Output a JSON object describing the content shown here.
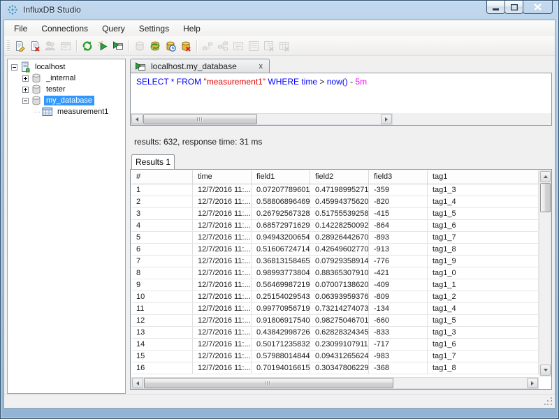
{
  "window": {
    "title": "InfluxDB Studio"
  },
  "colors": {
    "selection": "#3297fd",
    "keyword": "#0000ff",
    "string": "#e00000",
    "duration": "#ff00ff"
  },
  "menu": {
    "items": [
      "File",
      "Connections",
      "Query",
      "Settings",
      "Help"
    ]
  },
  "toolbar": {
    "buttons": [
      {
        "name": "edit-connection",
        "icon": "doc-edit",
        "enabled": true
      },
      {
        "name": "delete-connection",
        "icon": "doc-delete",
        "enabled": true
      },
      {
        "name": "manage-users",
        "icon": "users",
        "enabled": false
      },
      {
        "name": "connection-properties",
        "icon": "properties",
        "enabled": false
      },
      {
        "sep": true
      },
      {
        "name": "refresh",
        "icon": "refresh",
        "enabled": true
      },
      {
        "name": "run-query",
        "icon": "run",
        "enabled": true
      },
      {
        "name": "run-query-new-tab",
        "icon": "run-tab",
        "enabled": true
      },
      {
        "sep": true
      },
      {
        "name": "create-database",
        "icon": "database",
        "enabled": false
      },
      {
        "name": "refresh-databases",
        "icon": "database-refresh",
        "enabled": true
      },
      {
        "name": "retention-policies",
        "icon": "database-clock",
        "enabled": true
      },
      {
        "name": "drop-database",
        "icon": "database-delete",
        "enabled": true
      },
      {
        "sep": true
      },
      {
        "name": "show-queries",
        "icon": "link",
        "enabled": false
      },
      {
        "name": "show-shards",
        "icon": "link-add",
        "enabled": false
      },
      {
        "name": "show-stats",
        "icon": "view-text",
        "enabled": false
      },
      {
        "name": "show-diagnostics",
        "icon": "view-list",
        "enabled": false
      },
      {
        "name": "kill-query",
        "icon": "list-delete",
        "enabled": false
      },
      {
        "name": "drop-series",
        "icon": "table-delete",
        "enabled": false
      }
    ]
  },
  "connection_tree": {
    "nodes": [
      {
        "label": "localhost",
        "icon": "server",
        "expand": "minus",
        "level": 0,
        "selected": false
      },
      {
        "label": "_internal",
        "icon": "database",
        "expand": "plus",
        "level": 1,
        "selected": false
      },
      {
        "label": "tester",
        "icon": "database",
        "expand": "plus",
        "level": 1,
        "selected": false
      },
      {
        "label": "my_database",
        "icon": "database",
        "expand": "minus",
        "level": 1,
        "selected": true
      },
      {
        "label": "measurement1",
        "icon": "table",
        "expand": "none",
        "level": 2,
        "selected": false
      }
    ]
  },
  "query_tab": {
    "label": "localhost.my_database",
    "close_label": "x"
  },
  "query_editor": {
    "tokens": [
      {
        "text": "SELECT * FROM ",
        "color": "#0000ff"
      },
      {
        "text": "\"measurement1\"",
        "color": "#e00000"
      },
      {
        "text": " ",
        "color": "#000000"
      },
      {
        "text": "WHERE time ",
        "color": "#0000ff"
      },
      {
        "text": "> ",
        "color": "#202020"
      },
      {
        "text": "now()",
        "color": "#0000ff"
      },
      {
        "text": " - ",
        "color": "#202020"
      },
      {
        "text": "5m",
        "color": "#ff00ff"
      }
    ]
  },
  "result_summary": "results: 632, response time: 31 ms",
  "results": {
    "tab_label": "Results 1",
    "columns": [
      "#",
      "time",
      "field1",
      "field2",
      "field3",
      "tag1"
    ],
    "rows": [
      [
        "1",
        "12/7/2016 11:...",
        "0.07207789601...",
        "0.47198995271...",
        "-359",
        "tag1_3"
      ],
      [
        "2",
        "12/7/2016 11:...",
        "0.58806896469...",
        "0.45994375620...",
        "-820",
        "tag1_4"
      ],
      [
        "3",
        "12/7/2016 11:...",
        "0.26792567328...",
        "0.51755539258...",
        "-415",
        "tag1_5"
      ],
      [
        "4",
        "12/7/2016 11:...",
        "0.68572971629...",
        "0.14228250092...",
        "-864",
        "tag1_6"
      ],
      [
        "5",
        "12/7/2016 11:...",
        "0.94943200654...",
        "0.28926442670...",
        "-893",
        "tag1_7"
      ],
      [
        "6",
        "12/7/2016 11:...",
        "0.51606724714...",
        "0.42649602770...",
        "-913",
        "tag1_8"
      ],
      [
        "7",
        "12/7/2016 11:...",
        "0.36813158465...",
        "0.07929358914...",
        "-776",
        "tag1_9"
      ],
      [
        "8",
        "12/7/2016 11:...",
        "0.98993773804...",
        "0.88365307910...",
        "-421",
        "tag1_0"
      ],
      [
        "9",
        "12/7/2016 11:...",
        "0.56469987219...",
        "0.07007138620...",
        "-409",
        "tag1_1"
      ],
      [
        "10",
        "12/7/2016 11:...",
        "0.25154029543...",
        "0.06393959376...",
        "-809",
        "tag1_2"
      ],
      [
        "11",
        "12/7/2016 11:...",
        "0.99770956719...",
        "0.73214274073...",
        "-134",
        "tag1_4"
      ],
      [
        "12",
        "12/7/2016 11:...",
        "0.91806917540...",
        "0.98275046701...",
        "-660",
        "tag1_5"
      ],
      [
        "13",
        "12/7/2016 11:...",
        "0.43842998726...",
        "0.62828324345...",
        "-833",
        "tag1_3"
      ],
      [
        "14",
        "12/7/2016 11:...",
        "0.50171235832...",
        "0.23099107911...",
        "-717",
        "tag1_6"
      ],
      [
        "15",
        "12/7/2016 11:...",
        "0.57988014844...",
        "0.09431265624...",
        "-983",
        "tag1_7"
      ],
      [
        "16",
        "12/7/2016 11:...",
        "0.70194016615...",
        "0.30347806229...",
        "-368",
        "tag1_8"
      ]
    ]
  }
}
